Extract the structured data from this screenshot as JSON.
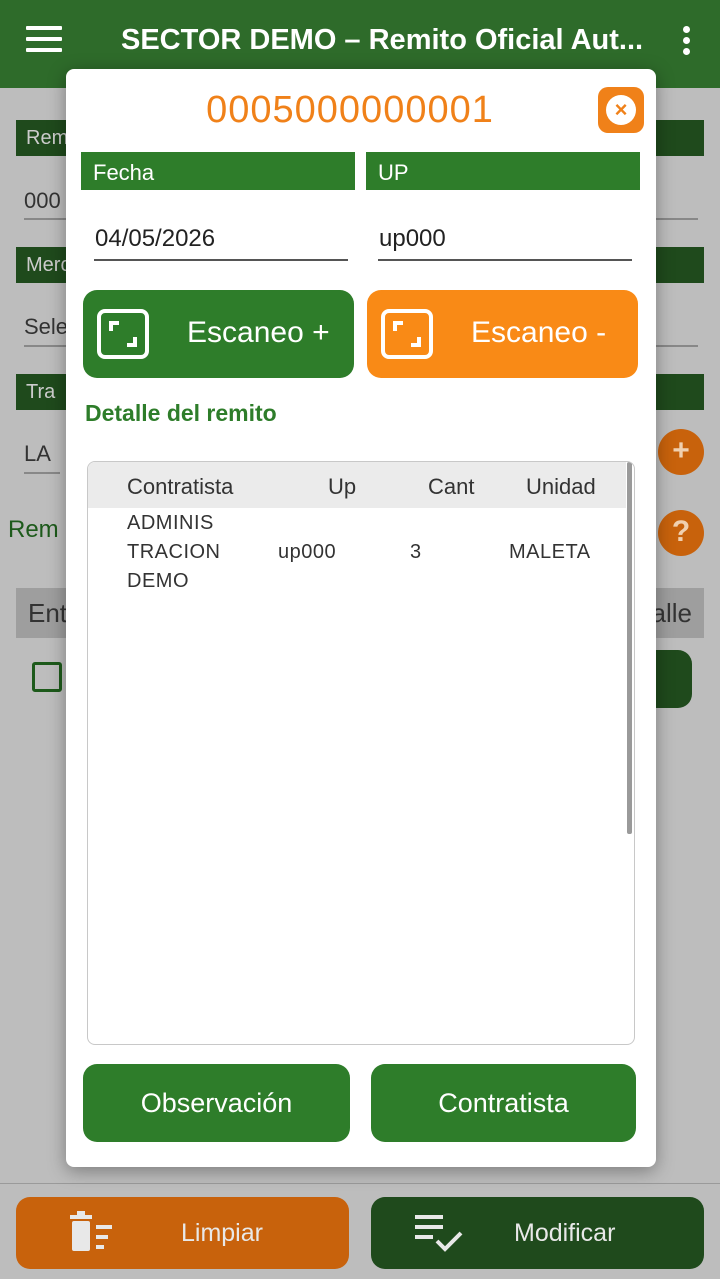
{
  "app_bar": {
    "title": "SECTOR DEMO – Remito Oficial Aut..."
  },
  "background": {
    "label_1": "Rem",
    "value_1": "000",
    "label_2": "Merc",
    "value_2": "Sele",
    "label_3": "Tra",
    "value_3": "LA",
    "rem_text": "Rem",
    "tab_left": "Ent",
    "tab_right": "alle",
    "plus_icon": "+",
    "help_icon": "?"
  },
  "dialog": {
    "title": "0005000000001",
    "close_icon": "×",
    "fecha_label": "Fecha",
    "fecha_value": "04/05/2026",
    "up_label": "UP",
    "up_value": "up000",
    "scan_plus": "Escaneo +",
    "scan_minus": "Escaneo -",
    "detail_title": "Detalle del remito",
    "table": {
      "headers": [
        "Contratista",
        "Up",
        "Cant",
        "Unidad"
      ],
      "rows": [
        {
          "contratista_l1": "ADMINIS",
          "contratista_l2": "TRACION",
          "contratista_l3": "DEMO",
          "up": "up000",
          "cant": "3",
          "unidad": "MALETA"
        }
      ]
    },
    "btn_observacion": "Observación",
    "btn_contratista": "Contratista"
  },
  "bottom_bar": {
    "clear_label": "Limpiar",
    "modify_label": "Modificar"
  },
  "colors": {
    "green": "#2e7d2a",
    "orange": "#f98a16",
    "dark_green": "#1f4a1c"
  }
}
